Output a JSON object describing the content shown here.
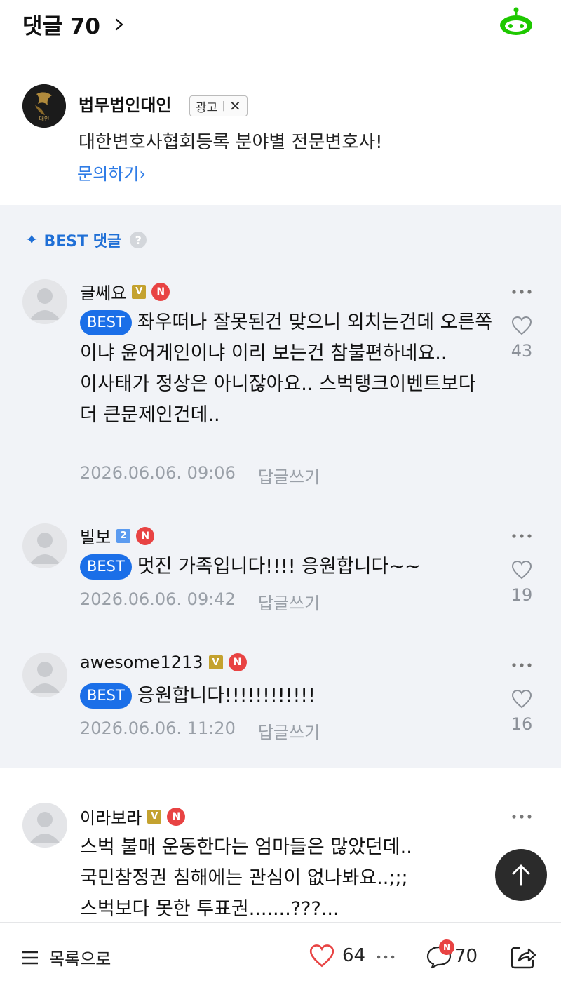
{
  "header": {
    "title": "댓글 70",
    "bot_icon": "chatbot-icon"
  },
  "ad": {
    "advertiser": "법무법인대인",
    "logo_text": "대인",
    "badge": "광고",
    "description": "대한변호사협회등록 분야별 전문변호사!",
    "cta": "문의하기"
  },
  "best_section": {
    "label": "BEST 댓글",
    "help": "?"
  },
  "comments": [
    {
      "nickname": "글쎄요",
      "level_badge": "V",
      "n_badge": "N",
      "best_label": "BEST",
      "text": "좌우떠나 잘못된건 맞으니 외치는건데 오른쪽이냐 윤어게인이냐 이리 보는건 참불편하네요..\n이사태가 정상은 아니잖아요.. 스벅탱크이벤트보다 더 큰문제인건데..",
      "datetime": "2026.06.06. 09:06",
      "reply": "답글쓰기",
      "likes": "43"
    },
    {
      "nickname": "빌보",
      "level_badge": "2",
      "n_badge": "N",
      "best_label": "BEST",
      "text": "멋진 가족입니다!!!! 응원합니다~~",
      "datetime": "2026.06.06. 09:42",
      "reply": "답글쓰기",
      "likes": "19"
    },
    {
      "nickname": "awesome1213",
      "level_badge": "V",
      "n_badge": "N",
      "best_label": "BEST",
      "text": "응원합니다!!!!!!!!!!!!",
      "datetime": "2026.06.06. 11:20",
      "reply": "답글쓰기",
      "likes": "16"
    },
    {
      "nickname": "이라보라",
      "level_badge": "V",
      "n_badge": "N",
      "text": "스벅 불매 운동한다는 엄마들은 많았던데..\n국민참정권 침해에는 관심이 없나봐요..;;;\n스벅보다 못한 투표권.......???..."
    }
  ],
  "bottom_bar": {
    "list_label": "목록으로",
    "like_count": "64",
    "comment_badge": "N",
    "comment_count": "70"
  },
  "colors": {
    "accent_blue": "#1b6fe8",
    "link_blue": "#2f7ce6",
    "best_bg": "#f1f3f7",
    "new_red": "#e84343",
    "bot_green": "#1ec800"
  }
}
